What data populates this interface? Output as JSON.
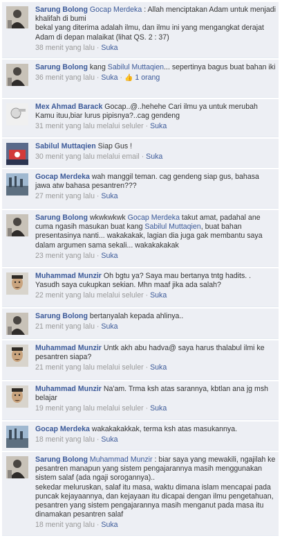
{
  "comments": [
    {
      "author": "Sarung Bolong",
      "avatar": "sarung-bolong-avatar",
      "mention": "Gocap Merdeka",
      "text": " : Allah menciptakan Adam untuk menjadi khalifah di bumi\nbekal yang diterima adalah ilmu, dan ilmu ini yang mengangkat derajat Adam di depan malaikat (lihat QS. 2 : 37)",
      "time": "38 menit yang lalu",
      "sep": " · ",
      "like": "Suka",
      "likes": ""
    },
    {
      "author": "Sarung Bolong",
      "avatar": "sarung-bolong-avatar",
      "prefix": " kang ",
      "mention": "Sabilul Muttaqien",
      "text": "... sepertinya bagus buat bahan iki",
      "time": "36 menit yang lalu",
      "sep": " · ",
      "like": "Suka",
      "likes": "1 orang"
    },
    {
      "author": "Mex Ahmad Barack",
      "avatar": "mex-ahmad-barack-avatar",
      "text": " Gocap..@..hehehe Cari ilmu ya untuk merubah Kamu ituu,biar lurus pipisnya?..cag gendeng",
      "time": "31 menit yang lalu melalui seluler",
      "sep": " · ",
      "like": "Suka",
      "likes": ""
    },
    {
      "author": "Sabilul Muttaqien",
      "avatar": "sabilul-muttaqien-avatar",
      "text": " Siap Gus !",
      "time": "30 menit yang lalu melalui email",
      "sep": " · ",
      "like": "Suka",
      "likes": ""
    },
    {
      "author": "Gocap Merdeka",
      "avatar": "gocap-merdeka-avatar",
      "text": " wah manggil teman. cag gendeng siap gus, bahasa jawa atw bahasa pesantren???",
      "time": "27 menit yang lalu",
      "sep": " · ",
      "like": "Suka",
      "likes": ""
    },
    {
      "author": "Sarung Bolong",
      "avatar": "sarung-bolong-avatar",
      "prefix": " wkwkwkwk ",
      "mention": "Gocap Merdeka",
      "text": " takut amat, padahal ane cuma ngasih masukan buat kang ",
      "mention2": "Sabilul Muttaqien",
      "text2": ", buat bahan presentasinya nanti... wakakakak, lagian dia juga gak membantu saya dalam argumen sama sekali... wakakakakak",
      "time": "23 menit yang lalu",
      "sep": " · ",
      "like": "Suka",
      "likes": ""
    },
    {
      "author": "Muhammad Munzir",
      "avatar": "muhammad-munzir-avatar",
      "text": " Oh bgtu ya? Saya mau bertanya tntg hadits. . Yasudh saya cukupkan sekian. Mhn maaf jika ada salah?",
      "time": "22 menit yang lalu melalui seluler",
      "sep": " · ",
      "like": "Suka",
      "likes": ""
    },
    {
      "author": "Sarung Bolong",
      "avatar": "sarung-bolong-avatar",
      "text": " bertanyalah kepada ahlinya..",
      "time": "21 menit yang lalu",
      "sep": " · ",
      "like": "Suka",
      "likes": ""
    },
    {
      "author": "Muhammad Munzir",
      "avatar": "muhammad-munzir-avatar",
      "text": " Untk akh abu hadva@ saya harus thalabul ilmi ke pesantren siapa?",
      "time": "21 menit yang lalu melalui seluler",
      "sep": " · ",
      "like": "Suka",
      "likes": ""
    },
    {
      "author": "Muhammad Munzir",
      "avatar": "muhammad-munzir-avatar",
      "text": " Na'am. Trma ksh atas sarannya, kbtlan ana jg msh belajar",
      "time": "19 menit yang lalu melalui seluler",
      "sep": " · ",
      "like": "Suka",
      "likes": ""
    },
    {
      "author": "Gocap Merdeka",
      "avatar": "gocap-merdeka-avatar",
      "text": " wakakakakkak, terma ksh atas masukannya.",
      "time": "18 menit yang lalu",
      "sep": " · ",
      "like": "Suka",
      "likes": ""
    },
    {
      "author": "Sarung Bolong",
      "avatar": "sarung-bolong-avatar",
      "mention": "Muhammad Munzir",
      "text": " : biar saya yang mewakili, ngajilah ke pesantren manapun yang sistem pengajarannya masih menggunakan sistem salaf (ada ngaji sorogannya)..\nsekedar meluruskan, salaf itu masa, waktu dimana islam mencapai pada puncak kejayaannya, dan kejayaan itu dicapai dengan ilmu pengetahuan, pesantren yang sistem pengajarannya masih menganut pada masa itu dinamakan pesantren salaf",
      "time": "18 menit yang lalu",
      "sep": " · ",
      "like": "Suka",
      "likes": ""
    }
  ]
}
